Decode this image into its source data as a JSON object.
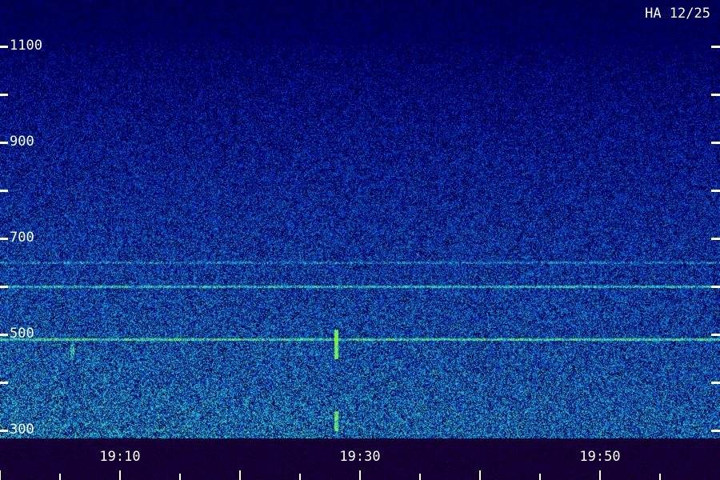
{
  "station_label": "HA 12/25",
  "colors": {
    "background": "#0a0a46",
    "low": "#1428b4",
    "mid": "#1ea0d2",
    "high": "#5aff46",
    "ticks": "#ffffff"
  },
  "chart_data": {
    "type": "heatmap",
    "description_of_axes": "radio spectrogram",
    "x_tick_labels": [
      "19:10",
      "19:30",
      "19:50"
    ],
    "x_range": [
      "19:00",
      "19:58"
    ],
    "y_tick_labels": [
      "1100",
      "900",
      "700",
      "500",
      "300"
    ],
    "y_range": [
      300,
      1100
    ],
    "emission_lines": [
      {
        "frequency": 490,
        "strength": 0.55
      },
      {
        "frequency": 600,
        "strength": 0.45
      },
      {
        "frequency": 650,
        "strength": 0.25
      }
    ],
    "bursts": [
      {
        "time": "19:28",
        "freq_min": 450,
        "freq_max": 510,
        "strength": 0.9
      },
      {
        "time": "19:28",
        "freq_min": 300,
        "freq_max": 340,
        "strength": 0.7
      },
      {
        "time": "19:06",
        "freq_min": 450,
        "freq_max": 480,
        "strength": 0.4
      }
    ]
  }
}
